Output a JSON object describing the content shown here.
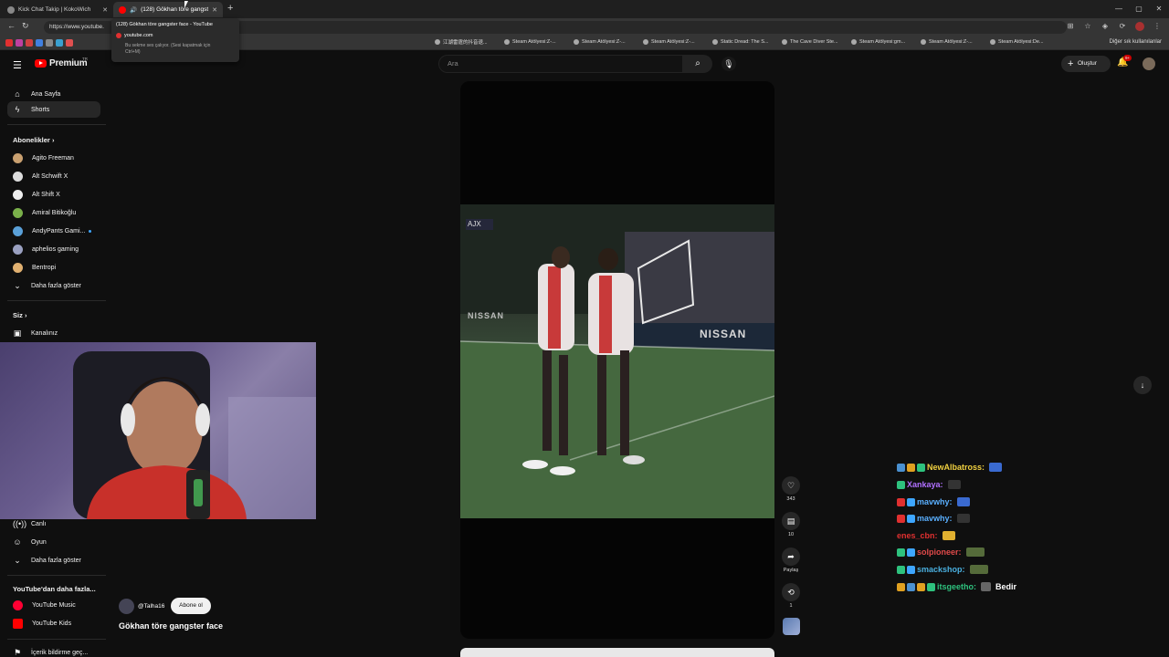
{
  "browser": {
    "tabs": [
      {
        "title": "Kick Chat Takip | KokoWich",
        "active": false
      },
      {
        "title": "(128) Gökhan töre gangster fa",
        "active": true
      }
    ],
    "url": "https://www.youtube.com/shorts/...",
    "url_visible": "https://www.youtube.",
    "tooltip": {
      "title": "(128) Gökhan töre gangster face - YouTube",
      "site": "youtube.com",
      "note": "Bu sekme ses çalıyor. (Sesi kapatmak için Ctrl+M)"
    },
    "bookmarks": [
      "江湖雷霆的抖音退...",
      "Steam Atölyesi:Z-...",
      "Steam Atölyesi:Z-...",
      "Steam Atölyesi:Z-...",
      "Static Dread: The S...",
      "The Cave Diver Ste...",
      "Steam Atölyesi:gm...",
      "Steam Atölyesi:Z-...",
      "Steam Atölyesi:De..."
    ],
    "other_bookmarks": "Diğer sık kullanılanlar"
  },
  "header": {
    "logo": "Premium",
    "logo_region": "TR",
    "search_placeholder": "Ara",
    "create_label": "Oluştur",
    "notif_count": "9+"
  },
  "sidebar": {
    "home": "Ana Sayfa",
    "shorts": "Shorts",
    "subs_title": "Abonelikler",
    "subs": [
      {
        "name": "Agito Freeman",
        "color": "#c9a070"
      },
      {
        "name": "Alt Schwift X",
        "color": "#dddddd"
      },
      {
        "name": "Alt Shift X",
        "color": "#eeeeee"
      },
      {
        "name": "Amiral Bitikoğlu",
        "color": "#7ab04a"
      },
      {
        "name": "AndyPants Gami...",
        "color": "#5aa0d8"
      },
      {
        "name": "aphelios gaming",
        "color": "#9aa0c0"
      },
      {
        "name": "Bentropi",
        "color": "#e0b070"
      }
    ],
    "show_more": "Daha fazla göster",
    "you_title": "Siz",
    "your_channel": "Kanalınız",
    "live": "Canlı",
    "gaming": "Oyun",
    "show_more2": "Daha fazla göster",
    "more_from": "YouTube'dan daha fazla...",
    "yt_music": "YouTube Music",
    "yt_kids": "YouTube Kids",
    "report": "İçerik bildirme geç..."
  },
  "video": {
    "overlay_tag": "AJX",
    "ad_text": "NISSAN",
    "ad_text2": "NISSAN",
    "likes": "343",
    "comments": "10",
    "share": "Paylaş",
    "remix": "1",
    "channel": "@Talha16",
    "subscribe": "Abone ol",
    "title": "Gökhan töre gangster face"
  },
  "chat": [
    {
      "user": "NewAlbatross:",
      "color": "#f0d040",
      "text": "",
      "badges": [
        "#4a90d0",
        "#e0a020",
        "#2ec27e"
      ]
    },
    {
      "user": "Xankaya:",
      "color": "#b070ff",
      "text": "",
      "badges": [
        "#2ec27e"
      ]
    },
    {
      "user": "mavwhy:",
      "color": "#5ab0ff",
      "text": "",
      "badges": [
        "#e03030",
        "#3ea6ff"
      ]
    },
    {
      "user": "mavwhy:",
      "color": "#5ab0ff",
      "text": "",
      "badges": [
        "#e03030",
        "#3ea6ff"
      ]
    },
    {
      "user": "enes_cbn:",
      "color": "#e03030",
      "text": "",
      "badges": []
    },
    {
      "user": "solpioneer:",
      "color": "#e04a4a",
      "text": "",
      "badges": [
        "#2ec27e",
        "#3ea6ff"
      ]
    },
    {
      "user": "smackshop:",
      "color": "#4ab0e0",
      "text": "",
      "badges": [
        "#2ec27e",
        "#3ea6ff"
      ]
    },
    {
      "user": "itsgeetho:",
      "color": "#2ec27e",
      "text": "Bedir",
      "badges": [
        "#e0a020",
        "#4a90d0",
        "#e0a020",
        "#2ec27e"
      ]
    }
  ]
}
